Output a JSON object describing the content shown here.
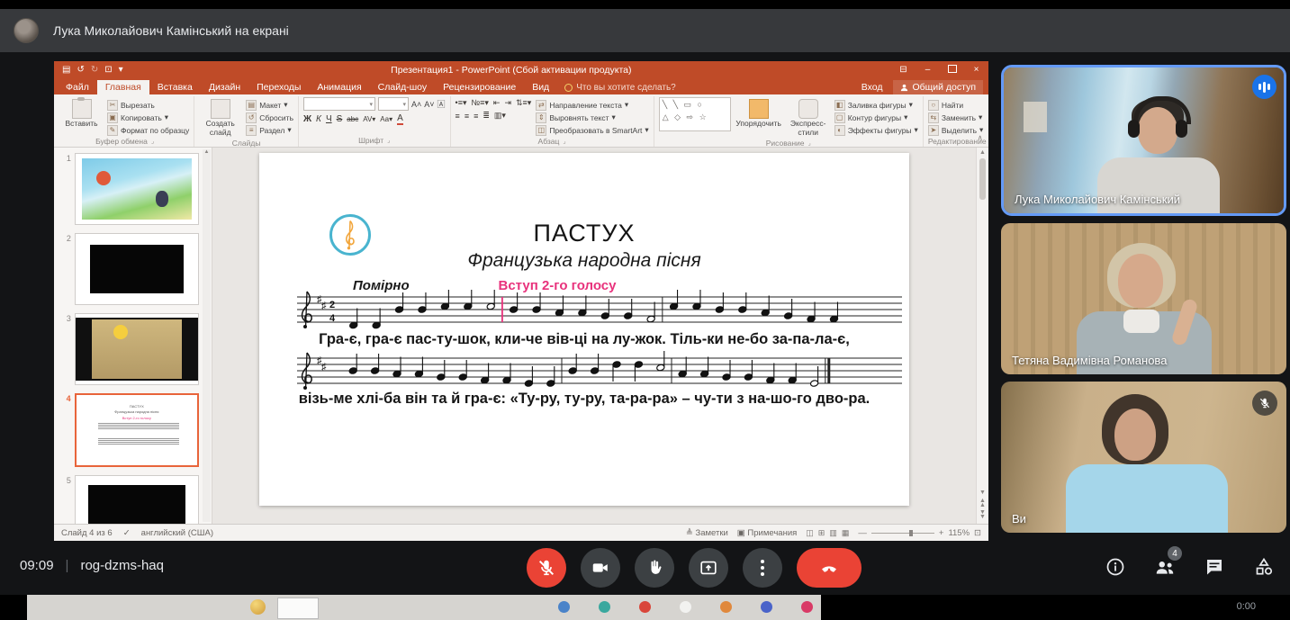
{
  "banner": {
    "title": "Лука Миколайович Камінський на екрані"
  },
  "powerpoint": {
    "window_title": "Презентация1 - PowerPoint (Сбой активации продукта)",
    "account": {
      "signin": "Вход",
      "share": "Общий доступ"
    },
    "tellme": "Что вы хотите сделать?",
    "tabs": [
      "Файл",
      "Главная",
      "Вставка",
      "Дизайн",
      "Переходы",
      "Анимация",
      "Слайд-шоу",
      "Рецензирование",
      "Вид"
    ],
    "active_tab": "Главная",
    "ribbon": {
      "clipboard": {
        "label": "Буфер обмена",
        "paste": "Вставить",
        "cut": "Вырезать",
        "copy": "Копировать",
        "format_painter": "Формат по образцу"
      },
      "slides": {
        "label": "Слайды",
        "new_slide": "Создать слайд",
        "layout": "Макет",
        "reset": "Сбросить",
        "section": "Раздел"
      },
      "font": {
        "label": "Шрифт"
      },
      "paragraph": {
        "label": "Абзац",
        "text_direction": "Направление текста",
        "align_text": "Выровнять текст",
        "smartart": "Преобразовать в SmartArt"
      },
      "drawing": {
        "label": "Рисование",
        "arrange": "Упорядочить",
        "quick_styles": "Экспресс-стили",
        "shape_fill": "Заливка фигуры",
        "shape_outline": "Контур фигуры",
        "shape_effects": "Эффекты фигуры"
      },
      "editing": {
        "label": "Редактирование",
        "find": "Найти",
        "replace": "Заменить",
        "select": "Выделить"
      }
    },
    "slides_panel": {
      "count": 6,
      "selected": 4,
      "kinds": [
        "cartoon",
        "video-black",
        "video-title",
        "sheet-music",
        "video-black",
        "photo"
      ]
    },
    "slide": {
      "title": "ПАСТУХ",
      "subtitle": "Французька народна пісня",
      "tempo": "Помірно",
      "cue": "Вступ 2-го голосу",
      "lyrics_line1": "Гра-є, гра-є пас-ту-шок, кли-че вів-ці на лу-жок. Тіль-ки не-бо за-па-ла-є,",
      "lyrics_line2": "візь-ме хлі-ба він та й гра-є: «Ту-ру, ту-ру, та-ра-ра» – чу-ти з на-шо-го дво-ра.",
      "time_signature_top": "2",
      "time_signature_bottom": "4",
      "music": {
        "staff1": [
          "q-5",
          "q-5",
          "q0",
          "q0",
          "q1",
          "q1",
          "h1",
          "barp",
          "q0",
          "q0",
          "q-1",
          "q-1",
          "q-2",
          "q-2",
          "h-3",
          "bar",
          "q1",
          "q1",
          "q0",
          "q0",
          "q-1",
          "q-2",
          "q-3",
          "q-3"
        ],
        "staff2": [
          "q0",
          "q0",
          "q-1",
          "q-1",
          "q-2",
          "q-2",
          "q-3",
          "q-3",
          "q-4",
          "q-4",
          "bar",
          "q0",
          "q0",
          "q2",
          "q2",
          "h1",
          "bar",
          "q-1",
          "q-1",
          "q-2",
          "q-2",
          "q-3",
          "q-3",
          "h-4",
          "end"
        ]
      }
    },
    "statusbar": {
      "slide_indicator": "Слайд 4 из 6",
      "language": "английский (США)",
      "notes": "Заметки",
      "comments": "Примечания",
      "zoom": "115%"
    }
  },
  "participants": [
    {
      "name": "Лука Миколайович Камінський",
      "status": "speaking"
    },
    {
      "name": "Тетяна Вадимівна Романова",
      "status": "camera-on"
    },
    {
      "name": "Ви",
      "status": "muted"
    }
  ],
  "meet": {
    "time": "09:09",
    "code": "rog-dzms-haq",
    "participants_badge": "4",
    "control_icons": [
      "mic-off",
      "camera",
      "raise-hand",
      "present-screen",
      "more-options",
      "end-call"
    ],
    "panel_icons": [
      "info",
      "participants",
      "chat",
      "activities"
    ]
  },
  "bottom_strip": {
    "video_time": "0:00",
    "icon_colors": [
      "#4a83c9",
      "#3aa89e",
      "#d9463a",
      "#f2f2f0",
      "#e0883c",
      "#4a63c9",
      "#d93a66"
    ]
  },
  "colors": {
    "ppt_accent": "#bf4b28",
    "selection": "#e8643a",
    "cue_pink": "#e8327c",
    "meet_red": "#ea4335",
    "speaker_blue": "#1a73e8",
    "active_border": "#649af7"
  }
}
